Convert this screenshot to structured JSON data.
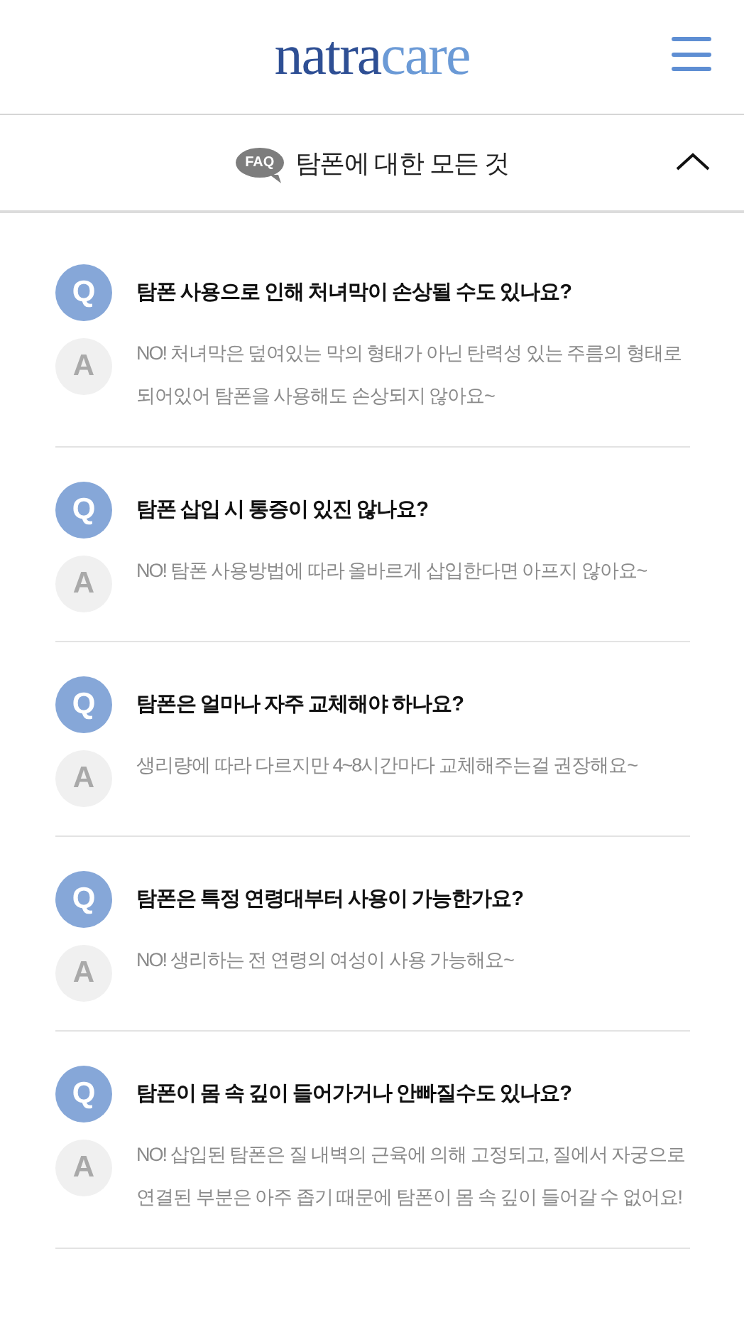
{
  "header": {
    "logo": {
      "first": "natra",
      "second": "care"
    }
  },
  "faq_bar": {
    "badge": "FAQ",
    "title": "탐폰에 대한 모든 것",
    "expanded": true
  },
  "items": [
    {
      "q_mark": "Q",
      "question": "탐폰 사용으로 인해 처녀막이 손상될 수도 있나요?",
      "a_mark": "A",
      "answer": "NO! 처녀막은 덮여있는 막의 형태가 아닌 탄력성 있는 주름의 형태로 되어있어 탐폰을 사용해도 손상되지 않아요~"
    },
    {
      "q_mark": "Q",
      "question": "탐폰 삽입 시 통증이 있진 않나요?",
      "a_mark": "A",
      "answer": "NO! 탐폰 사용방법에 따라 올바르게 삽입한다면 아프지 않아요~"
    },
    {
      "q_mark": "Q",
      "question": "탐폰은 얼마나 자주 교체해야 하나요?",
      "a_mark": "A",
      "answer": "생리량에 따라 다르지만 4~8시간마다 교체해주는걸 권장해요~"
    },
    {
      "q_mark": "Q",
      "question": "탐폰은 특정 연령대부터 사용이 가능한가요?",
      "a_mark": "A",
      "answer": "NO! 생리하는 전 연령의 여성이 사용 가능해요~"
    },
    {
      "q_mark": "Q",
      "question": "탐폰이 몸 속 깊이 들어가거나 안빠질수도 있나요?",
      "a_mark": "A",
      "answer": "NO! 삽입된 탐폰은 질 내벽의 근육에 의해 고정되고, 질에서 자궁으로 연결된 부분은 아주 좁기 때문에 탐폰이 몸 속 깊이 들어갈 수 없어요!"
    }
  ]
}
